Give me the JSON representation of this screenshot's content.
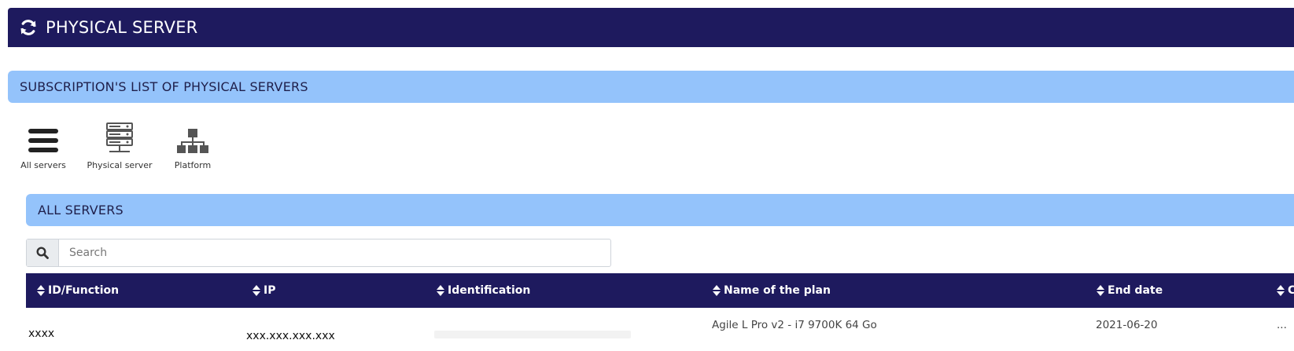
{
  "header": {
    "title": "PHYSICAL SERVER",
    "icon": "refresh-icon",
    "bg_color": "#1e1a5e"
  },
  "subscription": {
    "title": "SUBSCRIPTION'S LIST OF PHYSICAL SERVERS",
    "bg_color": "#94c3fb"
  },
  "filters": [
    {
      "label": "All servers",
      "icon": "list-icon"
    },
    {
      "label": "Physical server",
      "icon": "server-rack-icon"
    },
    {
      "label": "Platform",
      "icon": "network-icon"
    }
  ],
  "servers_section": {
    "title": "ALL SERVERS"
  },
  "search": {
    "placeholder": "Search",
    "value": ""
  },
  "table": {
    "columns": [
      "ID/Function",
      "IP",
      "Identification",
      "Name of the plan",
      "End date",
      "C"
    ],
    "rows": [
      {
        "id": "xxxx",
        "ip": "xxx.xxx.xxx.xxx",
        "identification": "",
        "plan": "Agile L Pro v2 - i7 9700K 64 Go",
        "end_date": "2021-06-20",
        "extra": "..."
      }
    ]
  }
}
